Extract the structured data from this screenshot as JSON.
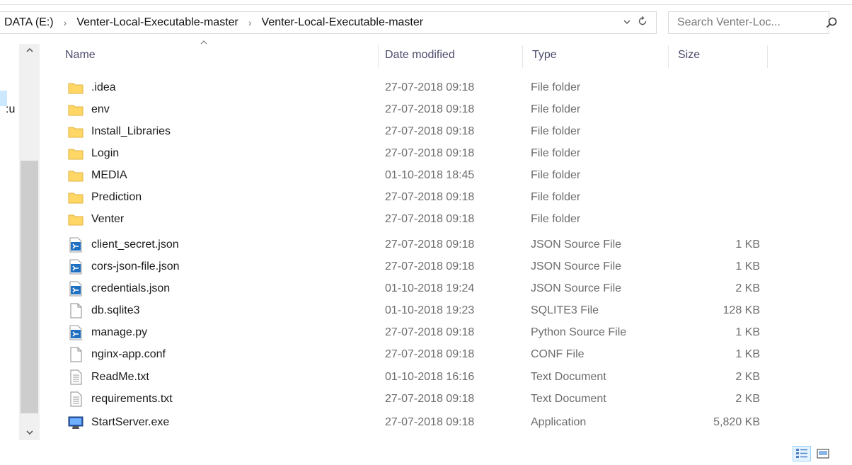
{
  "address": {
    "crumbs": [
      "DATA (E:)",
      "Venter-Local-Executable-master",
      "Venter-Local-Executable-master"
    ],
    "separator": "›"
  },
  "search": {
    "placeholder": "Search Venter-Loc..."
  },
  "nav": {
    "partial_label": ":u"
  },
  "columns": {
    "name": "Name",
    "date": "Date modified",
    "type": "Type",
    "size": "Size"
  },
  "files": [
    {
      "name": ".idea",
      "date": "27-07-2018 09:18",
      "type": "File folder",
      "size": "",
      "icon": "folder-icon"
    },
    {
      "name": "env",
      "date": "27-07-2018 09:18",
      "type": "File folder",
      "size": "",
      "icon": "folder-icon"
    },
    {
      "name": "Install_Libraries",
      "date": "27-07-2018 09:18",
      "type": "File folder",
      "size": "",
      "icon": "folder-icon"
    },
    {
      "name": "Login",
      "date": "27-07-2018 09:18",
      "type": "File folder",
      "size": "",
      "icon": "folder-icon"
    },
    {
      "name": "MEDIA",
      "date": "01-10-2018 18:45",
      "type": "File folder",
      "size": "",
      "icon": "folder-icon"
    },
    {
      "name": "Prediction",
      "date": "27-07-2018 09:18",
      "type": "File folder",
      "size": "",
      "icon": "folder-icon"
    },
    {
      "name": "Venter",
      "date": "27-07-2018 09:18",
      "type": "File folder",
      "size": "",
      "icon": "folder-icon"
    },
    {
      "name": "client_secret.json",
      "date": "27-07-2018 09:18",
      "type": "JSON Source File",
      "size": "1 KB",
      "icon": "vscode-file-icon"
    },
    {
      "name": "cors-json-file.json",
      "date": "27-07-2018 09:18",
      "type": "JSON Source File",
      "size": "1 KB",
      "icon": "vscode-file-icon"
    },
    {
      "name": "credentials.json",
      "date": "01-10-2018 19:24",
      "type": "JSON Source File",
      "size": "2 KB",
      "icon": "vscode-file-icon"
    },
    {
      "name": "db.sqlite3",
      "date": "01-10-2018 19:23",
      "type": "SQLITE3 File",
      "size": "128 KB",
      "icon": "blank-file-icon"
    },
    {
      "name": "manage.py",
      "date": "27-07-2018 09:18",
      "type": "Python Source File",
      "size": "1 KB",
      "icon": "vscode-file-icon"
    },
    {
      "name": "nginx-app.conf",
      "date": "27-07-2018 09:18",
      "type": "CONF File",
      "size": "1 KB",
      "icon": "blank-file-icon"
    },
    {
      "name": "ReadMe.txt",
      "date": "01-10-2018 16:16",
      "type": "Text Document",
      "size": "2 KB",
      "icon": "text-file-icon"
    },
    {
      "name": "requirements.txt",
      "date": "27-07-2018 09:18",
      "type": "Text Document",
      "size": "2 KB",
      "icon": "text-file-icon"
    },
    {
      "name": "StartServer.exe",
      "date": "27-07-2018 09:18",
      "type": "Application",
      "size": "5,820 KB",
      "icon": "application-icon"
    }
  ],
  "colors": {
    "folder": "#ffd766",
    "vscode_blue": "#1f70c1",
    "selection": "#cce8ff",
    "header_text": "#4c4c6d",
    "meta_text": "#6d6d6d"
  }
}
